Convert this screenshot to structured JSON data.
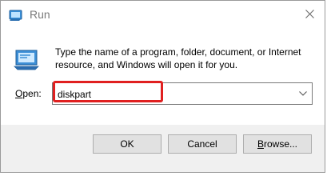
{
  "window": {
    "title": "Run"
  },
  "content": {
    "description": "Type the name of a program, folder, document, or Internet resource, and Windows will open it for you.",
    "open_label_accel": "O",
    "open_label_rest": "pen:",
    "open_value": "diskpart"
  },
  "buttons": {
    "ok": "OK",
    "cancel": "Cancel",
    "browse_accel": "B",
    "browse_rest": "rowse..."
  },
  "colors": {
    "highlight": "#e02020",
    "button_bg": "#e1e1e1",
    "footer_bg": "#f0f0f0"
  },
  "icons": {
    "title": "run-icon",
    "app": "run-app-icon",
    "close": "close-icon",
    "dropdown": "chevron-down-icon"
  }
}
